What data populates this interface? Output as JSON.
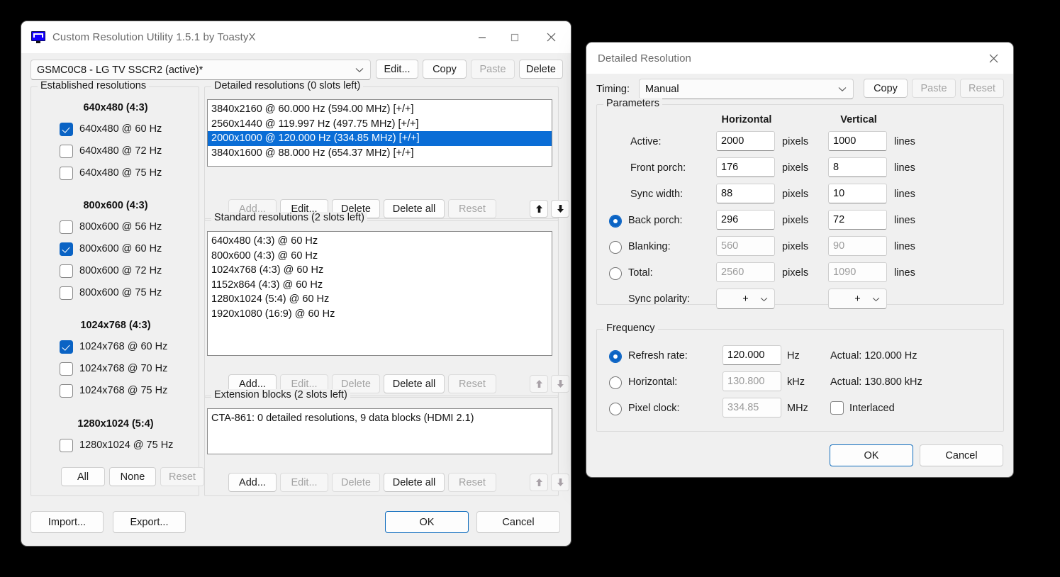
{
  "main_window": {
    "title": "Custom Resolution Utility 1.5.1 by ToastyX",
    "icon": "monitor-icon",
    "window_controls": {
      "minimize": "minimize-icon",
      "maximize": "maximize-icon",
      "close": "close-icon"
    },
    "display_select": {
      "value": "GSMC0C8 - LG TV SSCR2 (active)*",
      "caret": "chevron-down-icon"
    },
    "toolbar": [
      {
        "label": "Edit...",
        "name": "edit-display-button",
        "disabled": false
      },
      {
        "label": "Copy",
        "name": "copy-display-button",
        "disabled": false
      },
      {
        "label": "Paste",
        "name": "paste-display-button",
        "disabled": true
      },
      {
        "label": "Delete",
        "name": "delete-display-button",
        "disabled": false
      }
    ],
    "established": {
      "legend": "Established resolutions",
      "groups": [
        {
          "title": "640x480 (4:3)",
          "items": [
            {
              "label": "640x480 @ 60 Hz",
              "checked": true
            },
            {
              "label": "640x480 @ 72 Hz",
              "checked": false
            },
            {
              "label": "640x480 @ 75 Hz",
              "checked": false
            }
          ]
        },
        {
          "title": "800x600 (4:3)",
          "items": [
            {
              "label": "800x600 @ 56 Hz",
              "checked": false
            },
            {
              "label": "800x600 @ 60 Hz",
              "checked": true
            },
            {
              "label": "800x600 @ 72 Hz",
              "checked": false
            },
            {
              "label": "800x600 @ 75 Hz",
              "checked": false
            }
          ]
        },
        {
          "title": "1024x768 (4:3)",
          "items": [
            {
              "label": "1024x768 @ 60 Hz",
              "checked": true
            },
            {
              "label": "1024x768 @ 70 Hz",
              "checked": false
            },
            {
              "label": "1024x768 @ 75 Hz",
              "checked": false
            }
          ]
        },
        {
          "title": "1280x1024 (5:4)",
          "items": [
            {
              "label": "1280x1024 @ 75 Hz",
              "checked": false
            }
          ]
        }
      ],
      "buttons": [
        {
          "label": "All",
          "name": "select-all-button",
          "disabled": false
        },
        {
          "label": "None",
          "name": "select-none-button",
          "disabled": false
        },
        {
          "label": "Reset",
          "name": "reset-established-button",
          "disabled": true
        }
      ]
    },
    "detailed": {
      "legend": "Detailed resolutions (0 slots left)",
      "items": [
        {
          "label": "3840x2160 @ 60.000 Hz (594.00 MHz) [+/+]",
          "selected": false
        },
        {
          "label": "2560x1440 @ 119.997 Hz (497.75 MHz) [+/+]",
          "selected": false
        },
        {
          "label": "2000x1000 @ 120.000 Hz (334.85 MHz) [+/+]",
          "selected": true
        },
        {
          "label": "3840x1600 @ 88.000 Hz (654.37 MHz) [+/+]",
          "selected": false
        }
      ],
      "buttons": [
        {
          "label": "Add...",
          "name": "add-detailed-button",
          "disabled": true
        },
        {
          "label": "Edit...",
          "name": "edit-detailed-button",
          "disabled": false
        },
        {
          "label": "Delete",
          "name": "delete-detailed-button",
          "disabled": false
        },
        {
          "label": "Delete all",
          "name": "delete-all-detailed-button",
          "disabled": false
        },
        {
          "label": "Reset",
          "name": "reset-detailed-button",
          "disabled": true
        }
      ],
      "move_up": "arrow-up-icon",
      "move_down": "arrow-down-icon",
      "move_enabled": true
    },
    "standard": {
      "legend": "Standard resolutions (2 slots left)",
      "items": [
        "640x480 (4:3) @ 60 Hz",
        "800x600 (4:3) @ 60 Hz",
        "1024x768 (4:3) @ 60 Hz",
        "1152x864 (4:3) @ 60 Hz",
        "1280x1024 (5:4) @ 60 Hz",
        "1920x1080 (16:9) @ 60 Hz"
      ],
      "buttons": [
        {
          "label": "Add...",
          "name": "add-standard-button",
          "disabled": false
        },
        {
          "label": "Edit...",
          "name": "edit-standard-button",
          "disabled": true
        },
        {
          "label": "Delete",
          "name": "delete-standard-button",
          "disabled": true
        },
        {
          "label": "Delete all",
          "name": "delete-all-standard-button",
          "disabled": false
        },
        {
          "label": "Reset",
          "name": "reset-standard-button",
          "disabled": true
        }
      ],
      "move_up": "arrow-up-icon",
      "move_down": "arrow-down-icon",
      "move_enabled": false
    },
    "extension": {
      "legend": "Extension blocks (2 slots left)",
      "items": [
        "CTA-861: 0 detailed resolutions, 9 data blocks (HDMI 2.1)"
      ],
      "buttons": [
        {
          "label": "Add...",
          "name": "add-extension-button",
          "disabled": false
        },
        {
          "label": "Edit...",
          "name": "edit-extension-button",
          "disabled": true
        },
        {
          "label": "Delete",
          "name": "delete-extension-button",
          "disabled": true
        },
        {
          "label": "Delete all",
          "name": "delete-all-extension-button",
          "disabled": false
        },
        {
          "label": "Reset",
          "name": "reset-extension-button",
          "disabled": true
        }
      ],
      "move_up": "arrow-up-icon",
      "move_down": "arrow-down-icon",
      "move_enabled": false
    },
    "footer": {
      "import": "Import...",
      "export": "Export...",
      "ok": "OK",
      "cancel": "Cancel"
    }
  },
  "dialog": {
    "title": "Detailed Resolution",
    "close": "close-icon",
    "timing": {
      "label": "Timing:",
      "value": "Manual",
      "caret": "chevron-down-icon"
    },
    "timing_buttons": [
      {
        "label": "Copy",
        "name": "copy-timing-button",
        "disabled": false
      },
      {
        "label": "Paste",
        "name": "paste-timing-button",
        "disabled": true
      },
      {
        "label": "Reset",
        "name": "reset-timing-button",
        "disabled": true
      }
    ],
    "parameters": {
      "legend": "Parameters",
      "col_h": "Horizontal",
      "col_v": "Vertical",
      "unit_h": "pixels",
      "unit_v": "lines",
      "rows": [
        {
          "label": "Active:",
          "radio": null,
          "h": "2000",
          "v": "1000",
          "dim": false
        },
        {
          "label": "Front porch:",
          "radio": null,
          "h": "176",
          "v": "8",
          "dim": false
        },
        {
          "label": "Sync width:",
          "radio": null,
          "h": "88",
          "v": "10",
          "dim": false
        },
        {
          "label": "Back porch:",
          "radio": true,
          "h": "296",
          "v": "72",
          "dim": false
        },
        {
          "label": "Blanking:",
          "radio": false,
          "h": "560",
          "v": "90",
          "dim": true
        },
        {
          "label": "Total:",
          "radio": false,
          "h": "2560",
          "v": "1090",
          "dim": true
        }
      ],
      "sync_polarity": {
        "label": "Sync polarity:",
        "h": "+",
        "v": "+",
        "caret": "chevron-down-icon"
      }
    },
    "frequency": {
      "legend": "Frequency",
      "rows": [
        {
          "label": "Refresh rate:",
          "selected": true,
          "value": "120.000",
          "unit": "Hz",
          "actual": "Actual: 120.000 Hz",
          "dim": false
        },
        {
          "label": "Horizontal:",
          "selected": false,
          "value": "130.800",
          "unit": "kHz",
          "actual": "Actual: 130.800 kHz",
          "dim": true
        },
        {
          "label": "Pixel clock:",
          "selected": false,
          "value": "334.85",
          "unit": "MHz",
          "actual": "",
          "dim": true
        }
      ],
      "interlaced": {
        "label": "Interlaced",
        "checked": false
      }
    },
    "footer": {
      "ok": "OK",
      "cancel": "Cancel"
    }
  },
  "colors": {
    "accent": "#0a6dd6",
    "selection": "#0a6dd6",
    "checkbox_on": "#0a63c4",
    "window_bg": "#f0f0f0",
    "desktop_bg": "#000000"
  }
}
